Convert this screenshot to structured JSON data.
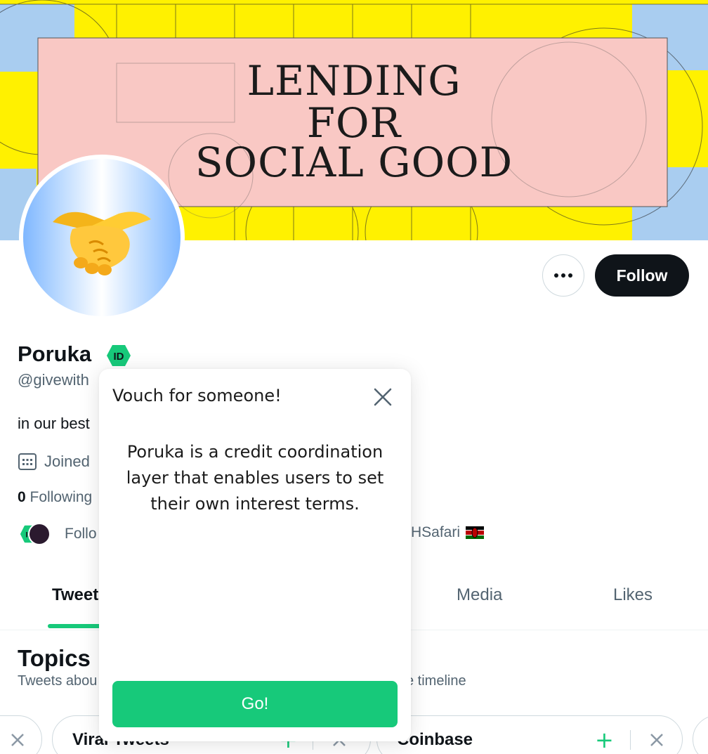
{
  "banner": {
    "line1": "LENDING",
    "line2": "FOR",
    "line3": "SOCIAL GOOD",
    "colors": {
      "yellow": "#fff100",
      "pink": "#f9c8c4",
      "blue": "#a9cdf0"
    }
  },
  "profile": {
    "name": "Poruka",
    "handle": "@givewith",
    "bio": "in our best",
    "joined": "Joined",
    "following_count": "0",
    "following_label": "Following",
    "followers_prefix": "Follo",
    "followers_suffix": "HSafari",
    "avatar_icon": "handshake-emoji-icon",
    "badge_icon": "id-badge-icon"
  },
  "actions": {
    "more_icon": "more-options-icon",
    "follow_label": "Follow"
  },
  "tabs": [
    {
      "label": "Tweet",
      "active": true
    },
    {
      "label": "Media",
      "active": false
    },
    {
      "label": "Likes",
      "active": false
    }
  ],
  "topics": {
    "title": "Topics",
    "subtitle_start": "Tweets abou",
    "subtitle_end": "e timeline",
    "chips": [
      {
        "label": ""
      },
      {
        "label": "Viral Tweets"
      },
      {
        "label": "Coinbase"
      }
    ]
  },
  "modal": {
    "title": "Vouch for someone!",
    "body": "Poruka is a credit coordination layer that enables users to set their own interest terms.",
    "button": "Go!",
    "close_icon": "close-icon"
  },
  "colors": {
    "accent_green": "#17c97a",
    "text_primary": "#0f1419",
    "text_secondary": "#536471"
  }
}
